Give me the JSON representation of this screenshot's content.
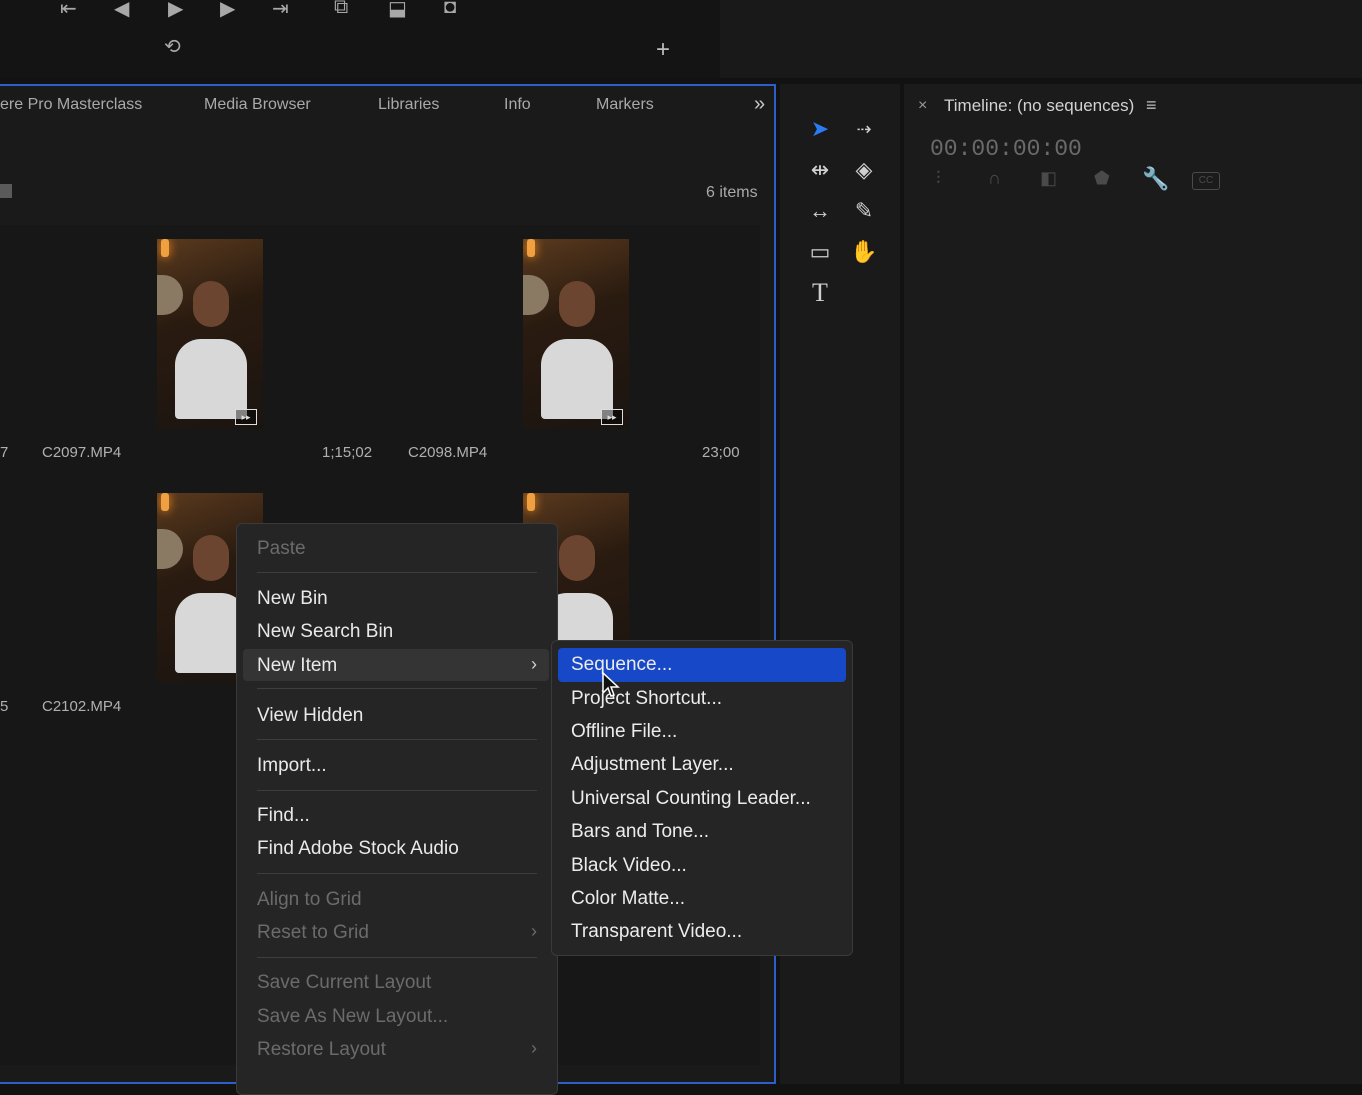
{
  "toolbar": {
    "icons": [
      "go-to-in-icon",
      "step-back-icon",
      "play-icon",
      "step-forward-icon",
      "go-to-out-icon",
      "insert-icon",
      "overwrite-icon",
      "export-frame-icon",
      "loop-icon",
      "add-button-icon"
    ]
  },
  "project_panel": {
    "tabs": [
      "ere Pro Masterclass",
      "Media Browser",
      "Libraries",
      "Info",
      "Markers"
    ],
    "overflow_glyph": "»",
    "items_count": "6 items",
    "clips": [
      {
        "name": "C2097.MP4",
        "duration": "1;15;02",
        "left_fragment": "7"
      },
      {
        "name": "C2098.MP4",
        "duration": "23;00"
      },
      {
        "name": "C2102.MP4",
        "duration": "",
        "left_fragment": "5"
      },
      {
        "name": "",
        "duration": ""
      }
    ]
  },
  "timeline": {
    "close_glyph": "×",
    "title": "Timeline: (no sequences)",
    "menu_glyph": "≡",
    "timecode": "00:00:00:00"
  },
  "context_menu": {
    "items": [
      {
        "label": "Paste",
        "disabled": true
      },
      {
        "label": "New Bin",
        "disabled": false
      },
      {
        "label": "New Search Bin",
        "disabled": false
      },
      {
        "label": "New Item",
        "disabled": false,
        "submenu": true,
        "highlighted": true
      },
      {
        "label": "View Hidden",
        "disabled": false
      },
      {
        "label": "Import...",
        "disabled": false
      },
      {
        "label": "Find...",
        "disabled": false
      },
      {
        "label": "Find Adobe Stock Audio",
        "disabled": false
      },
      {
        "label": "Align to Grid",
        "disabled": true
      },
      {
        "label": "Reset to Grid",
        "disabled": true,
        "submenu": true
      },
      {
        "label": "Save Current Layout",
        "disabled": true
      },
      {
        "label": "Save As New Layout...",
        "disabled": true
      },
      {
        "label": "Restore Layout",
        "disabled": true,
        "submenu": true
      }
    ]
  },
  "submenu": {
    "items": [
      {
        "label": "Sequence...",
        "highlighted": true
      },
      {
        "label": "Project Shortcut..."
      },
      {
        "label": "Offline File..."
      },
      {
        "label": "Adjustment Layer..."
      },
      {
        "label": "Universal Counting Leader..."
      },
      {
        "label": "Bars and Tone..."
      },
      {
        "label": "Black Video..."
      },
      {
        "label": "Color Matte..."
      },
      {
        "label": "Transparent Video..."
      }
    ]
  },
  "colors": {
    "accent": "#2c5fc9",
    "highlight": "#1748c8",
    "tool_active": "#2b7bf2"
  }
}
